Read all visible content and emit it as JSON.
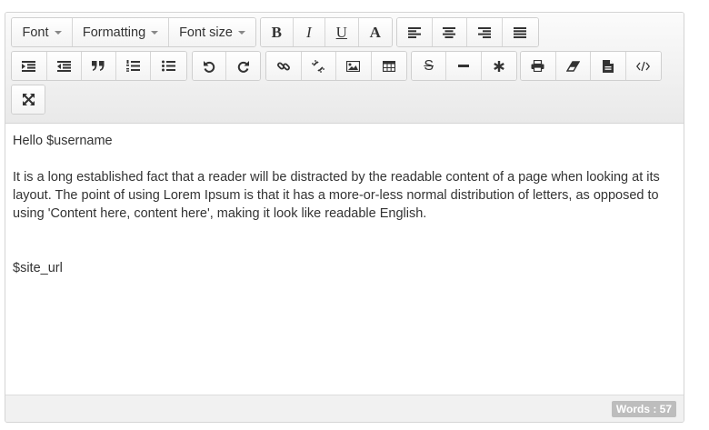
{
  "toolbar": {
    "font_label": "Font",
    "formatting_label": "Formatting",
    "font_size_label": "Font size",
    "bold_glyph": "B",
    "italic_glyph": "I",
    "underline_glyph": "U",
    "font_color_glyph": "A",
    "icons": [
      "bold-icon",
      "italic-icon",
      "underline-icon",
      "font-color-icon",
      "align-left-icon",
      "align-center-icon",
      "align-right-icon",
      "justify-icon",
      "indent-icon",
      "outdent-icon",
      "blockquote-icon",
      "ordered-list-icon",
      "unordered-list-icon",
      "undo-icon",
      "redo-icon",
      "link-icon",
      "unlink-icon",
      "image-icon",
      "table-icon",
      "strikethrough-icon",
      "horizontal-rule-icon",
      "special-char-icon",
      "print-icon",
      "eraser-icon",
      "template-icon",
      "source-code-icon",
      "fullscreen-icon"
    ]
  },
  "content": {
    "greeting": "Hello $username",
    "paragraph": "It is a long established fact that a reader will be distracted by the readable content of a page when looking at its layout. The point of using Lorem Ipsum is that it has a more-or-less normal distribution of letters, as opposed to using 'Content here, content here', making it look like readable English.",
    "site_url": "$site_url"
  },
  "status": {
    "word_count": "Words : 57"
  }
}
